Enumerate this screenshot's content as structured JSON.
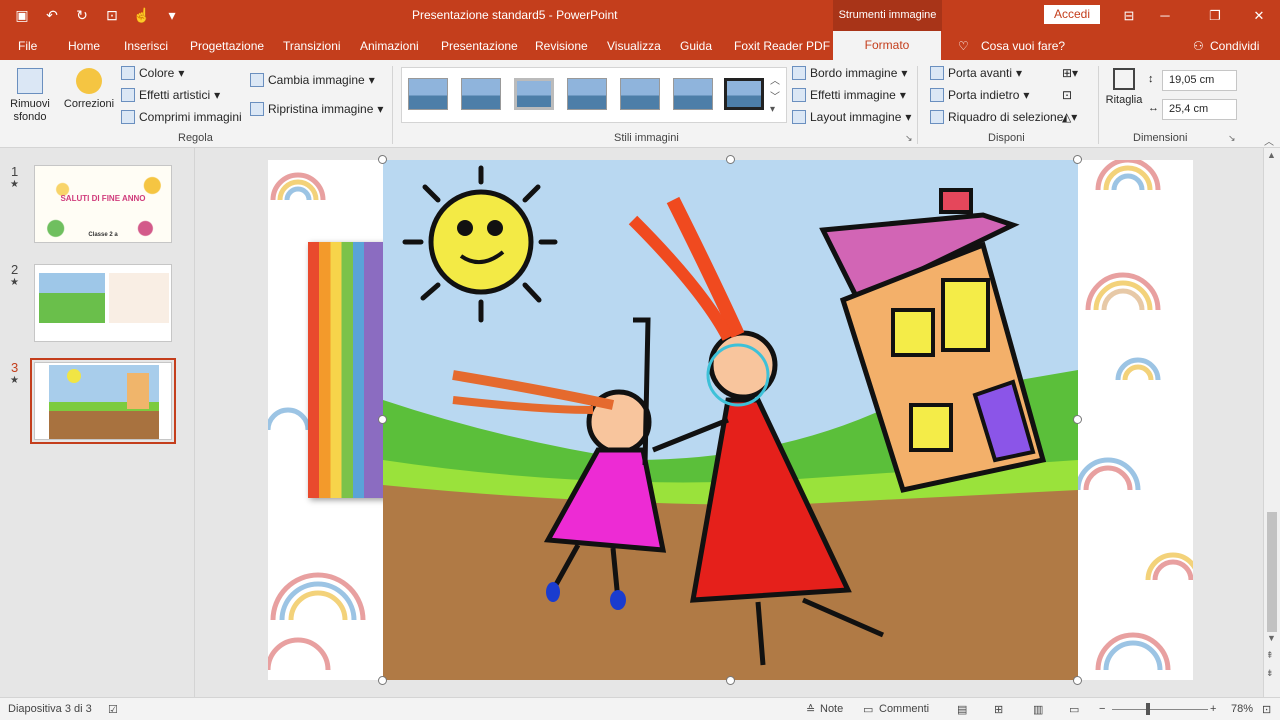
{
  "titlebar": {
    "title": "Presentazione standard5  -  PowerPoint",
    "context_tools": "Strumenti immagine",
    "signin": "Accedi"
  },
  "tabs": [
    "File",
    "Home",
    "Inserisci",
    "Progettazione",
    "Transizioni",
    "Animazioni",
    "Presentazione",
    "Revisione",
    "Visualizza",
    "Guida",
    "Foxit Reader PDF"
  ],
  "active_tab": "Formato",
  "tell_me": "Cosa vuoi fare?",
  "share": "Condividi",
  "ribbon": {
    "remove_bg": "Rimuovi sfondo",
    "corrections": "Correzioni",
    "color": "Colore",
    "artistic": "Effetti artistici",
    "compress": "Comprimi immagini",
    "change_pic": "Cambia immagine",
    "reset_pic": "Ripristina immagine",
    "group_adjust": "Regola",
    "group_styles": "Stili immagini",
    "border": "Bordo immagine",
    "effects": "Effetti immagine",
    "layout": "Layout immagine",
    "bring_forward": "Porta avanti",
    "send_backward": "Porta indietro",
    "selection_pane": "Riquadro di selezione",
    "group_arrange": "Disponi",
    "crop": "Ritaglia",
    "height": "19,05 cm",
    "width": "25,4 cm",
    "group_size": "Dimensioni"
  },
  "slides": [
    {
      "num": "1",
      "label": "SALUTI DI FINE ANNO",
      "sublabel": "Classe 2 a"
    },
    {
      "num": "2",
      "label": "",
      "sublabel": ""
    },
    {
      "num": "3",
      "label": "",
      "sublabel": ""
    }
  ],
  "statusbar": {
    "slide_info": "Diapositiva 3 di 3",
    "notes": "Note",
    "comments": "Commenti",
    "zoom": "78%"
  },
  "colors": {
    "accent": "#c43e1c",
    "ribbon_bg": "#f3f3f3"
  }
}
